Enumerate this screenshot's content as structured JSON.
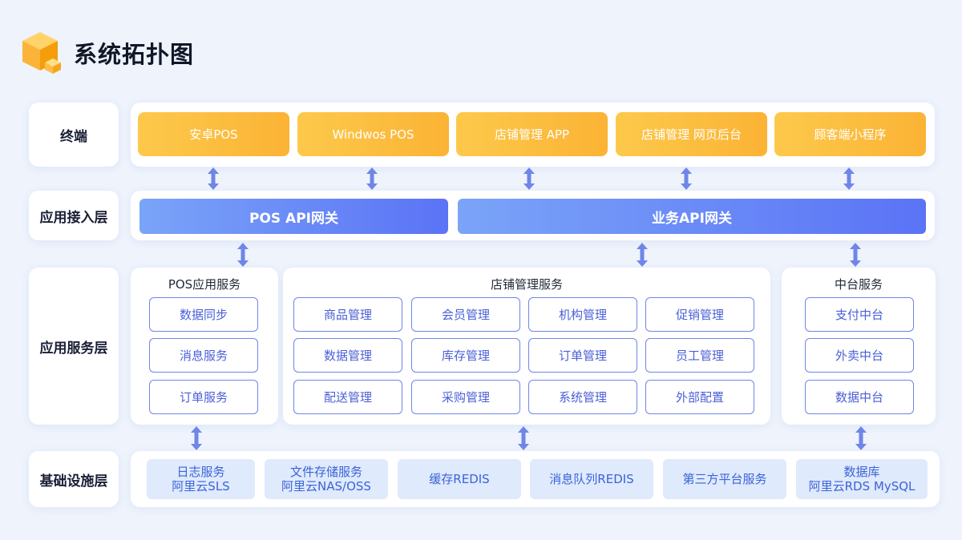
{
  "title": "系统拓扑图",
  "layers": {
    "terminal": {
      "label": "终端",
      "items": [
        "安卓POS",
        "Windwos POS",
        "店铺管理 APP",
        "店铺管理 网页后台",
        "顾客端小程序"
      ]
    },
    "access": {
      "label": "应用接入层",
      "gateways": [
        "POS API网关",
        "业务API网关"
      ]
    },
    "service": {
      "label": "应用服务层",
      "groups": [
        {
          "title": "POS应用服务",
          "items": [
            "数据同步",
            "消息服务",
            "订单服务"
          ]
        },
        {
          "title": "店铺管理服务",
          "items": [
            "商品管理",
            "会员管理",
            "机构管理",
            "促销管理",
            "数据管理",
            "库存管理",
            "订单管理",
            "员工管理",
            "配送管理",
            "采购管理",
            "系统管理",
            "外部配置"
          ]
        },
        {
          "title": "中台服务",
          "items": [
            "支付中台",
            "外卖中台",
            "数据中台"
          ]
        }
      ]
    },
    "infra": {
      "label": "基础设施层",
      "items": [
        {
          "line1": "日志服务",
          "line2": "阿里云SLS"
        },
        {
          "line1": "文件存储服务",
          "line2": "阿里云NAS/OSS"
        },
        {
          "line1": "缓存REDIS",
          "line2": ""
        },
        {
          "line1": "消息队列REDIS",
          "line2": ""
        },
        {
          "line1": "第三方平台服务",
          "line2": ""
        },
        {
          "line1": "数据库",
          "line2": "阿里云RDS MySQL"
        }
      ]
    }
  },
  "colors": {
    "terminal_tile": "#fbb335",
    "gateway": "#5b73f6",
    "service_border": "#6f86e8",
    "infra_tile": "#dfeafc",
    "connector": "#6f86e8"
  },
  "icons": {
    "logo": "cube-icon",
    "connector": "double-arrow-icon"
  }
}
